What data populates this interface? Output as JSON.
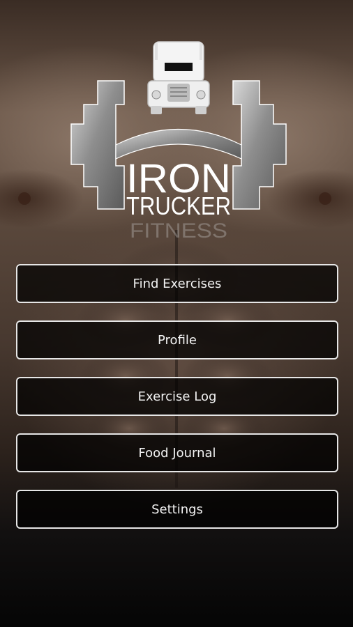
{
  "logo": {
    "line1": "IRON",
    "line2": "TRUCKER",
    "line3": "FITNESS"
  },
  "menu": {
    "items": [
      {
        "label": "Find Exercises"
      },
      {
        "label": "Profile"
      },
      {
        "label": "Exercise Log"
      },
      {
        "label": "Food Journal"
      },
      {
        "label": "Settings"
      }
    ]
  },
  "colors": {
    "button_border": "#e6e6e6",
    "button_text": "#f2f2f2",
    "logo_metal": "#9a9a9a"
  }
}
